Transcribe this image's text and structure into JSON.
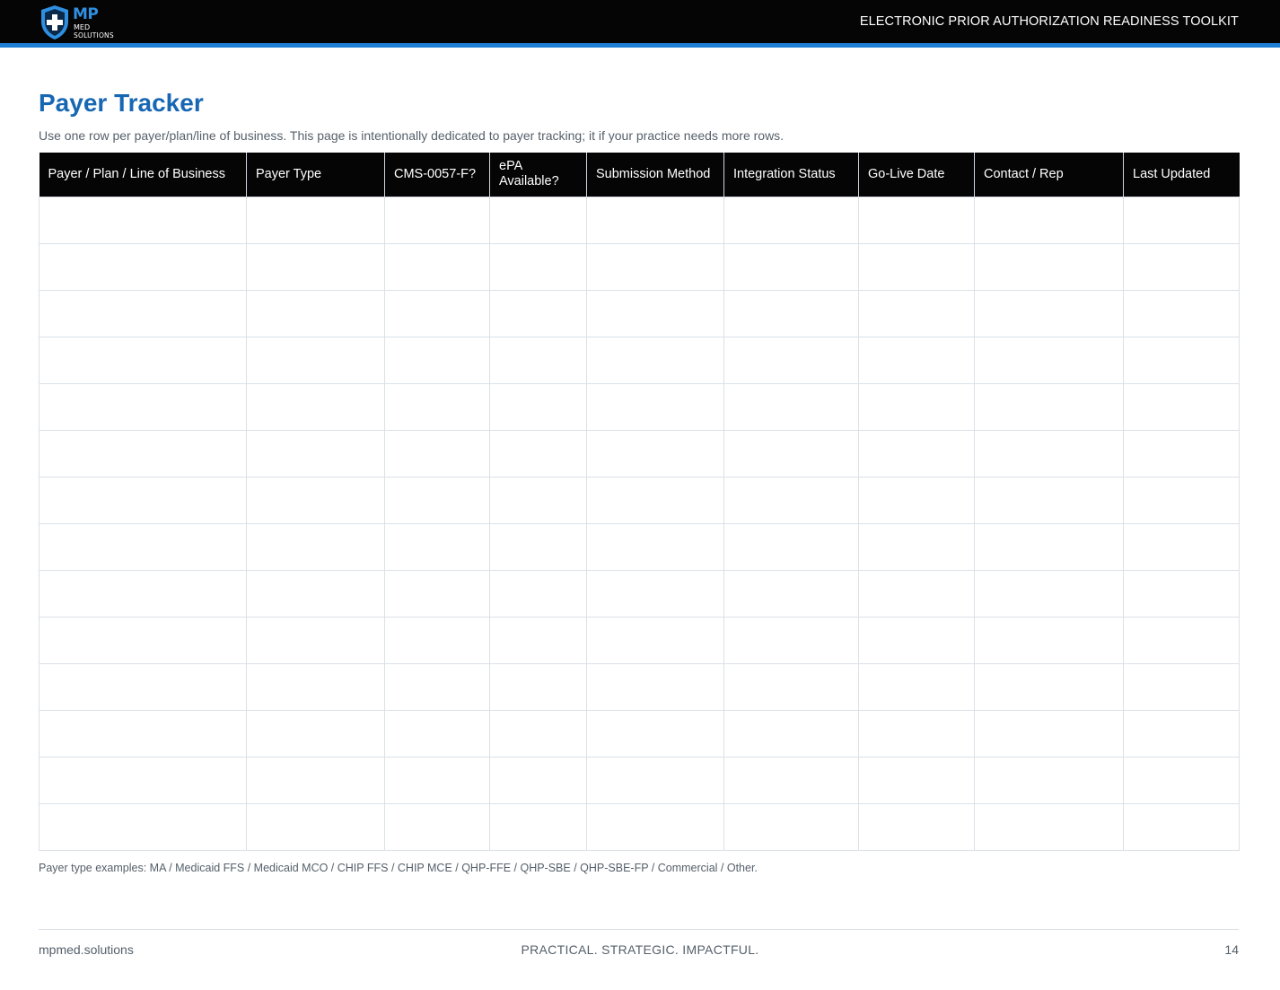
{
  "header": {
    "logo": {
      "mark": "MP",
      "line1": "MED",
      "line2": "SOLUTIONS",
      "icon": "shield-cross-icon",
      "brand_color": "#2f8fe0"
    },
    "toolkit_title": "ELECTRONIC PRIOR AUTHORIZATION READINESS TOOLKIT",
    "accent_color": "#1f7fd6"
  },
  "main": {
    "title": "Payer Tracker",
    "subtitle": "Use one row per payer/plan/line of business. This page is intentionally dedicated to payer tracking; it if your practice needs more rows.",
    "table": {
      "columns": [
        "Payer / Plan / Line of Business",
        "Payer Type",
        "CMS-0057-F?",
        "ePA Available?",
        "Submission Method",
        "Integration Status",
        "Go-Live Date",
        "Contact / Rep",
        "Last Updated"
      ],
      "rows": [
        [
          "",
          "",
          "",
          "",
          "",
          "",
          "",
          "",
          ""
        ],
        [
          "",
          "",
          "",
          "",
          "",
          "",
          "",
          "",
          ""
        ],
        [
          "",
          "",
          "",
          "",
          "",
          "",
          "",
          "",
          ""
        ],
        [
          "",
          "",
          "",
          "",
          "",
          "",
          "",
          "",
          ""
        ],
        [
          "",
          "",
          "",
          "",
          "",
          "",
          "",
          "",
          ""
        ],
        [
          "",
          "",
          "",
          "",
          "",
          "",
          "",
          "",
          ""
        ],
        [
          "",
          "",
          "",
          "",
          "",
          "",
          "",
          "",
          ""
        ],
        [
          "",
          "",
          "",
          "",
          "",
          "",
          "",
          "",
          ""
        ],
        [
          "",
          "",
          "",
          "",
          "",
          "",
          "",
          "",
          ""
        ],
        [
          "",
          "",
          "",
          "",
          "",
          "",
          "",
          "",
          ""
        ],
        [
          "",
          "",
          "",
          "",
          "",
          "",
          "",
          "",
          ""
        ],
        [
          "",
          "",
          "",
          "",
          "",
          "",
          "",
          "",
          ""
        ],
        [
          "",
          "",
          "",
          "",
          "",
          "",
          "",
          "",
          ""
        ],
        [
          "",
          "",
          "",
          "",
          "",
          "",
          "",
          "",
          ""
        ]
      ]
    },
    "footnote": "Payer type examples: MA / Medicaid FFS / Medicaid MCO / CHIP FFS / CHIP MCE / QHP-FFE / QHP-SBE / QHP-SBE-FP / Commercial / Other."
  },
  "footer": {
    "website": "mpmed.solutions",
    "tagline": "PRACTICAL. STRATEGIC. IMPACTFUL.",
    "page_number": "14"
  }
}
